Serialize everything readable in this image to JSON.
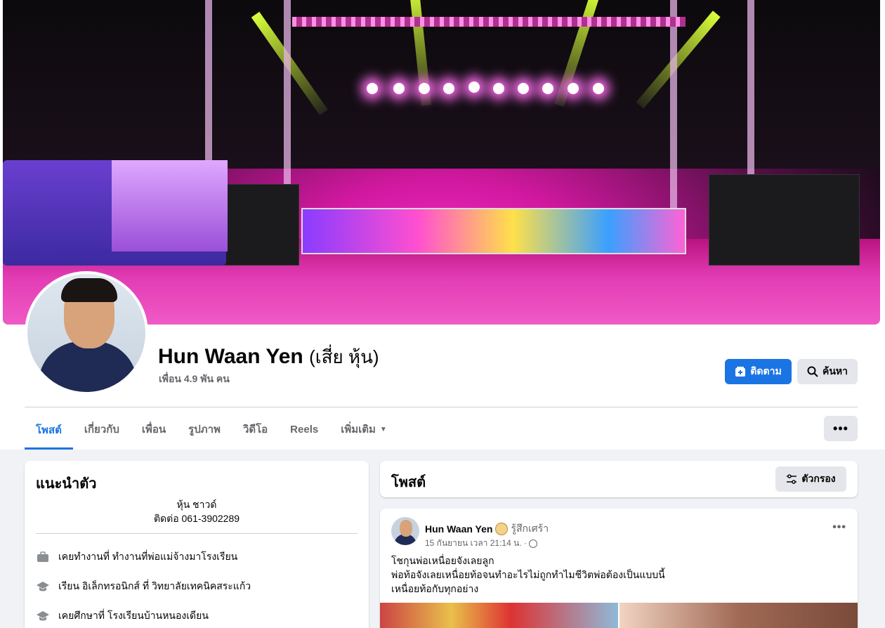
{
  "profile": {
    "name": "Hun Waan Yen",
    "nickname": "(เสี่ย หุ้น)",
    "friends": "เพื่อน 4.9 พัน คน"
  },
  "actions": {
    "follow_label": "ติดตาม",
    "search_label": "ค้นหา",
    "more_label": "•••"
  },
  "tabs": [
    {
      "label": "โพสต์",
      "active": true
    },
    {
      "label": "เกี่ยวกับ"
    },
    {
      "label": "เพื่อน"
    },
    {
      "label": "รูปภาพ"
    },
    {
      "label": "วิดีโอ"
    },
    {
      "label": "Reels"
    },
    {
      "label": "เพิ่มเติม"
    }
  ],
  "intro": {
    "title": "แนะนำตัว",
    "bio_line1": "หุ้น ชาวด์",
    "bio_line2": "ติดต่อ 061-3902289",
    "items": [
      {
        "icon": "briefcase-icon",
        "text": "เคยทำงานที่ ทำงานที่พ่อแม่จ้างมาโรงเรียน"
      },
      {
        "icon": "graduation-cap-icon",
        "text": "เรียน อิเล็กทรอนิกส์ ที่ วิทยาลัยเทคนิคสระแก้ว"
      },
      {
        "icon": "graduation-cap-icon",
        "text": "เคยศึกษาที่ โรงเรียนบ้านหนองเดียน"
      }
    ]
  },
  "posts_header": {
    "title": "โพสต์",
    "filter_label": "ตัวกรอง"
  },
  "post": {
    "author": "Hun Waan Yen",
    "feeling": "รู้สึกเศร้า",
    "time": "15 กันยายน เวลา 21:14 น. ·",
    "text_line1": "โชกุนพ่อเหนื่อยจังเลยลูก",
    "text_line2": "พ่อท้อจังเลยเหนื่อยท้อจนทำอะไรไม่ถูกทำไมชีวิตพ่อต้องเป็นแบบนี้",
    "text_line3": "เหนื่อยท้อกับทุกอย่าง",
    "more_label": "•••"
  },
  "colors": {
    "accent": "#1b74e4",
    "background": "#f0f2f5",
    "secondary_text": "#65676b"
  }
}
